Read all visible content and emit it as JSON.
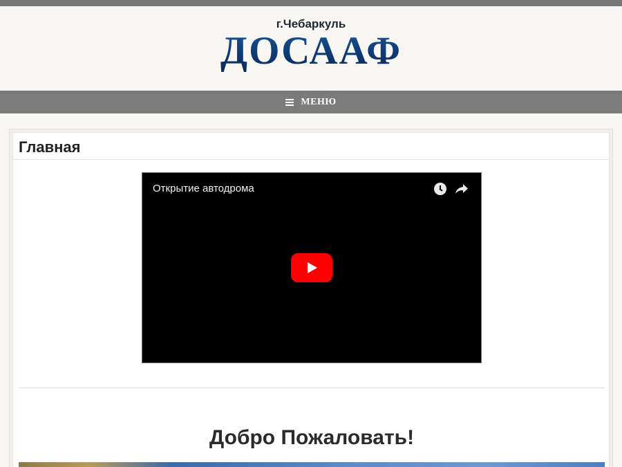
{
  "header": {
    "city": "г.Чебаркуль",
    "logo_text": "ДОСААФ"
  },
  "nav": {
    "menu_label": "МЕНЮ",
    "menu_icon": "hamburger-icon"
  },
  "page": {
    "title": "Главная"
  },
  "video": {
    "title": "Открытие автодрома",
    "icons": [
      "clock-icon",
      "share-icon",
      "play-icon"
    ],
    "play_color": "#ff0000"
  },
  "welcome": {
    "heading": "Добро Пожаловать!"
  },
  "colors": {
    "top_strip": "#777777",
    "navbar": "#7b7b7b",
    "logo": "#0f3f7d",
    "background": "#f7f6f3"
  }
}
